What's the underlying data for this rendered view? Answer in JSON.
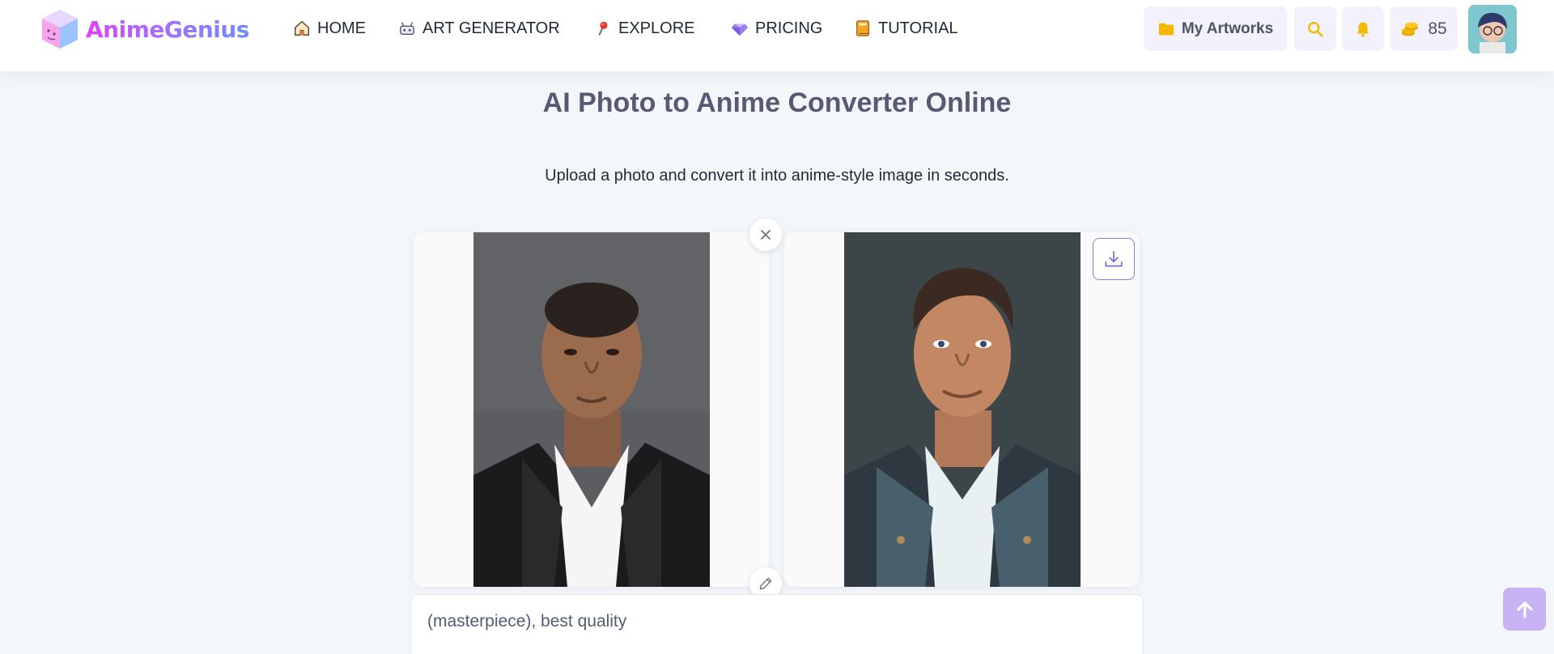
{
  "brand": {
    "name": "AnimeGenius"
  },
  "nav": {
    "home": "HOME",
    "art_generator": "ART GENERATOR",
    "explore": "EXPLORE",
    "pricing": "PRICING",
    "tutorial": "TUTORIAL"
  },
  "header_actions": {
    "my_artworks": "My Artworks",
    "credits": "85"
  },
  "main": {
    "title": "AI Photo to Anime Converter Online",
    "subtitle": "Upload a photo and convert it into anime-style image in seconds.",
    "prompt_value": "(masterpiece), best quality"
  },
  "icons": {
    "home": "home-icon",
    "art": "robot-icon",
    "explore": "pin-icon",
    "pricing": "diamond-icon",
    "tutorial": "book-icon",
    "folder": "folder-icon",
    "search": "search-icon",
    "bell": "bell-icon",
    "coins": "coins-icon",
    "close": "close-icon",
    "edit": "pencil-icon",
    "download": "download-icon",
    "back_to_top": "arrow-up-icon"
  },
  "colors": {
    "accent": "#a66cff",
    "icon_yellow": "#f5b800",
    "title": "#545b72",
    "download_border": "#8a7fd6",
    "back_top": "#c8b4f5"
  }
}
